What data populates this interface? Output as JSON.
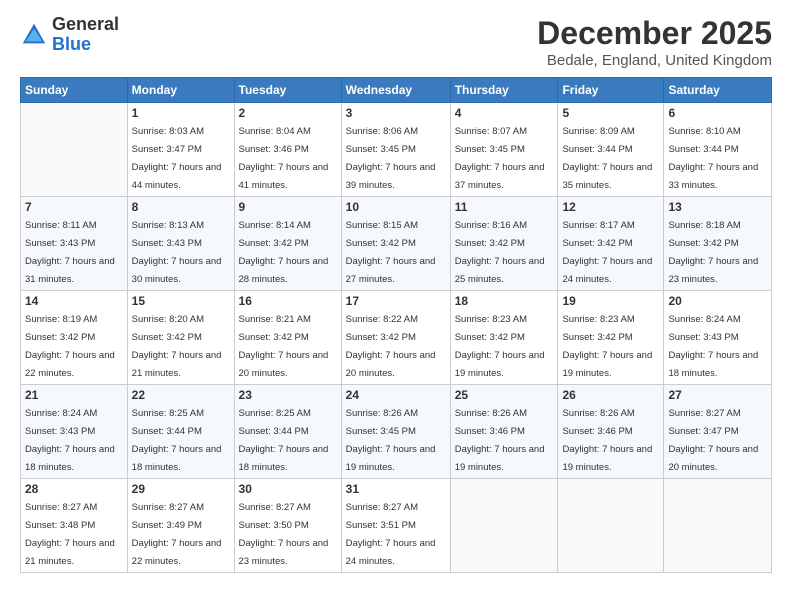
{
  "logo": {
    "general": "General",
    "blue": "Blue"
  },
  "header": {
    "month_title": "December 2025",
    "location": "Bedale, England, United Kingdom"
  },
  "weekdays": [
    "Sunday",
    "Monday",
    "Tuesday",
    "Wednesday",
    "Thursday",
    "Friday",
    "Saturday"
  ],
  "weeks": [
    [
      {
        "day": "",
        "sunrise": "",
        "sunset": "",
        "daylight": ""
      },
      {
        "day": "1",
        "sunrise": "Sunrise: 8:03 AM",
        "sunset": "Sunset: 3:47 PM",
        "daylight": "Daylight: 7 hours and 44 minutes."
      },
      {
        "day": "2",
        "sunrise": "Sunrise: 8:04 AM",
        "sunset": "Sunset: 3:46 PM",
        "daylight": "Daylight: 7 hours and 41 minutes."
      },
      {
        "day": "3",
        "sunrise": "Sunrise: 8:06 AM",
        "sunset": "Sunset: 3:45 PM",
        "daylight": "Daylight: 7 hours and 39 minutes."
      },
      {
        "day": "4",
        "sunrise": "Sunrise: 8:07 AM",
        "sunset": "Sunset: 3:45 PM",
        "daylight": "Daylight: 7 hours and 37 minutes."
      },
      {
        "day": "5",
        "sunrise": "Sunrise: 8:09 AM",
        "sunset": "Sunset: 3:44 PM",
        "daylight": "Daylight: 7 hours and 35 minutes."
      },
      {
        "day": "6",
        "sunrise": "Sunrise: 8:10 AM",
        "sunset": "Sunset: 3:44 PM",
        "daylight": "Daylight: 7 hours and 33 minutes."
      }
    ],
    [
      {
        "day": "7",
        "sunrise": "Sunrise: 8:11 AM",
        "sunset": "Sunset: 3:43 PM",
        "daylight": "Daylight: 7 hours and 31 minutes."
      },
      {
        "day": "8",
        "sunrise": "Sunrise: 8:13 AM",
        "sunset": "Sunset: 3:43 PM",
        "daylight": "Daylight: 7 hours and 30 minutes."
      },
      {
        "day": "9",
        "sunrise": "Sunrise: 8:14 AM",
        "sunset": "Sunset: 3:42 PM",
        "daylight": "Daylight: 7 hours and 28 minutes."
      },
      {
        "day": "10",
        "sunrise": "Sunrise: 8:15 AM",
        "sunset": "Sunset: 3:42 PM",
        "daylight": "Daylight: 7 hours and 27 minutes."
      },
      {
        "day": "11",
        "sunrise": "Sunrise: 8:16 AM",
        "sunset": "Sunset: 3:42 PM",
        "daylight": "Daylight: 7 hours and 25 minutes."
      },
      {
        "day": "12",
        "sunrise": "Sunrise: 8:17 AM",
        "sunset": "Sunset: 3:42 PM",
        "daylight": "Daylight: 7 hours and 24 minutes."
      },
      {
        "day": "13",
        "sunrise": "Sunrise: 8:18 AM",
        "sunset": "Sunset: 3:42 PM",
        "daylight": "Daylight: 7 hours and 23 minutes."
      }
    ],
    [
      {
        "day": "14",
        "sunrise": "Sunrise: 8:19 AM",
        "sunset": "Sunset: 3:42 PM",
        "daylight": "Daylight: 7 hours and 22 minutes."
      },
      {
        "day": "15",
        "sunrise": "Sunrise: 8:20 AM",
        "sunset": "Sunset: 3:42 PM",
        "daylight": "Daylight: 7 hours and 21 minutes."
      },
      {
        "day": "16",
        "sunrise": "Sunrise: 8:21 AM",
        "sunset": "Sunset: 3:42 PM",
        "daylight": "Daylight: 7 hours and 20 minutes."
      },
      {
        "day": "17",
        "sunrise": "Sunrise: 8:22 AM",
        "sunset": "Sunset: 3:42 PM",
        "daylight": "Daylight: 7 hours and 20 minutes."
      },
      {
        "day": "18",
        "sunrise": "Sunrise: 8:23 AM",
        "sunset": "Sunset: 3:42 PM",
        "daylight": "Daylight: 7 hours and 19 minutes."
      },
      {
        "day": "19",
        "sunrise": "Sunrise: 8:23 AM",
        "sunset": "Sunset: 3:42 PM",
        "daylight": "Daylight: 7 hours and 19 minutes."
      },
      {
        "day": "20",
        "sunrise": "Sunrise: 8:24 AM",
        "sunset": "Sunset: 3:43 PM",
        "daylight": "Daylight: 7 hours and 18 minutes."
      }
    ],
    [
      {
        "day": "21",
        "sunrise": "Sunrise: 8:24 AM",
        "sunset": "Sunset: 3:43 PM",
        "daylight": "Daylight: 7 hours and 18 minutes."
      },
      {
        "day": "22",
        "sunrise": "Sunrise: 8:25 AM",
        "sunset": "Sunset: 3:44 PM",
        "daylight": "Daylight: 7 hours and 18 minutes."
      },
      {
        "day": "23",
        "sunrise": "Sunrise: 8:25 AM",
        "sunset": "Sunset: 3:44 PM",
        "daylight": "Daylight: 7 hours and 18 minutes."
      },
      {
        "day": "24",
        "sunrise": "Sunrise: 8:26 AM",
        "sunset": "Sunset: 3:45 PM",
        "daylight": "Daylight: 7 hours and 19 minutes."
      },
      {
        "day": "25",
        "sunrise": "Sunrise: 8:26 AM",
        "sunset": "Sunset: 3:46 PM",
        "daylight": "Daylight: 7 hours and 19 minutes."
      },
      {
        "day": "26",
        "sunrise": "Sunrise: 8:26 AM",
        "sunset": "Sunset: 3:46 PM",
        "daylight": "Daylight: 7 hours and 19 minutes."
      },
      {
        "day": "27",
        "sunrise": "Sunrise: 8:27 AM",
        "sunset": "Sunset: 3:47 PM",
        "daylight": "Daylight: 7 hours and 20 minutes."
      }
    ],
    [
      {
        "day": "28",
        "sunrise": "Sunrise: 8:27 AM",
        "sunset": "Sunset: 3:48 PM",
        "daylight": "Daylight: 7 hours and 21 minutes."
      },
      {
        "day": "29",
        "sunrise": "Sunrise: 8:27 AM",
        "sunset": "Sunset: 3:49 PM",
        "daylight": "Daylight: 7 hours and 22 minutes."
      },
      {
        "day": "30",
        "sunrise": "Sunrise: 8:27 AM",
        "sunset": "Sunset: 3:50 PM",
        "daylight": "Daylight: 7 hours and 23 minutes."
      },
      {
        "day": "31",
        "sunrise": "Sunrise: 8:27 AM",
        "sunset": "Sunset: 3:51 PM",
        "daylight": "Daylight: 7 hours and 24 minutes."
      },
      {
        "day": "",
        "sunrise": "",
        "sunset": "",
        "daylight": ""
      },
      {
        "day": "",
        "sunrise": "",
        "sunset": "",
        "daylight": ""
      },
      {
        "day": "",
        "sunrise": "",
        "sunset": "",
        "daylight": ""
      }
    ]
  ]
}
